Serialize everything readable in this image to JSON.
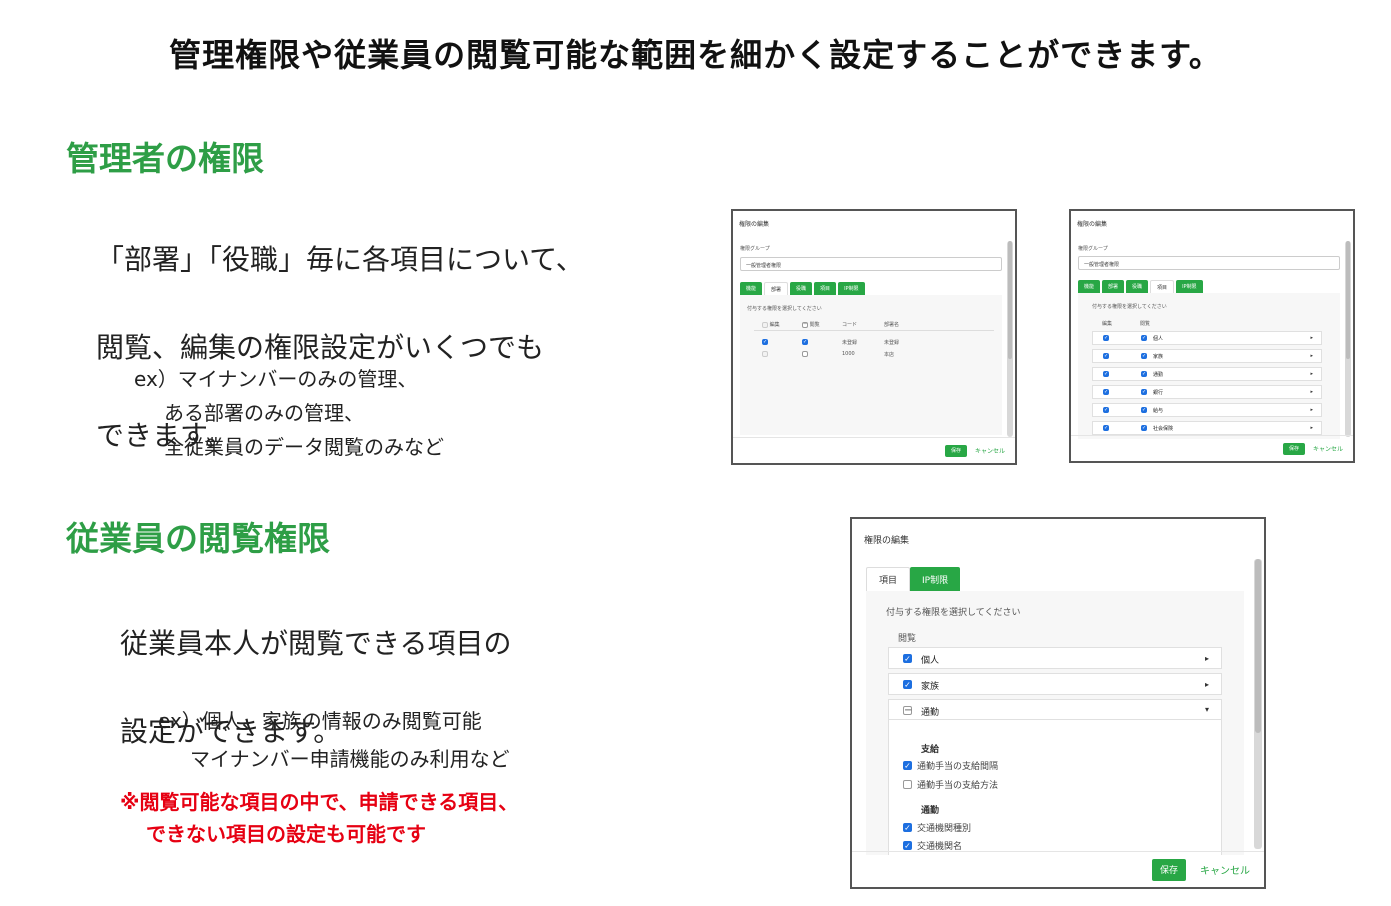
{
  "headline": "管理権限や従業員の閲覧可能な範囲を細かく設定することができます。",
  "admin": {
    "heading": "管理者の権限",
    "body_lines": [
      "「部署」「役職」毎に各項目について、",
      "閲覧、編集の権限設定がいくつでも",
      "できます。"
    ],
    "ex_lines": [
      "ex）マイナンバーのみの管理、",
      "ある部署のみの管理、",
      "全従業員のデータ閲覧のみなど"
    ]
  },
  "employee": {
    "heading": "従業員の閲覧権限",
    "body_lines": [
      "従業員本人が閲覧できる項目の",
      "設定ができます。"
    ],
    "ex_lines": [
      "ex）個人、家族の情報のみ閲覧可能",
      "マイナンバー申請機能のみ利用など"
    ],
    "note_lines": [
      "※閲覧可能な項目の中で、申請できる項目、",
      "できない項目の設定も可能です"
    ]
  },
  "dialog1": {
    "title": "権限の編集",
    "group_label": "権限グループ",
    "group_value": "一般管理者権限",
    "tabs": [
      "機能",
      "部署",
      "役職",
      "項目",
      "IP制限"
    ],
    "active_tab": "部署",
    "hint": "付与する権限を選択してください",
    "columns": [
      "編集",
      "閲覧",
      "コード",
      "部署名"
    ],
    "rows": [
      {
        "code": "未登録",
        "name": "未登録",
        "edit": true,
        "view": true
      },
      {
        "code": "1000",
        "name": "本店",
        "edit": false,
        "view": false
      }
    ],
    "save": "保存",
    "cancel": "キャンセル"
  },
  "dialog2": {
    "title": "権限の編集",
    "group_label": "権限グループ",
    "group_value": "一般管理者権限",
    "tabs": [
      "機能",
      "部署",
      "役職",
      "項目",
      "IP制限"
    ],
    "active_tab": "項目",
    "hint": "付与する権限を選択してください",
    "columns": [
      "編集",
      "閲覧"
    ],
    "items": [
      "個人",
      "家族",
      "通勤",
      "銀行",
      "給与",
      "社会保険"
    ],
    "save": "保存",
    "cancel": "キャンセル"
  },
  "dialog3": {
    "title": "権限の編集",
    "tabs": [
      "項目",
      "IP制限"
    ],
    "active_tab": "項目",
    "hint": "付与する権限を選択してください",
    "column": "閲覧",
    "items": [
      "個人",
      "家族",
      "通勤"
    ],
    "groups": [
      {
        "name": "支給",
        "options": [
          {
            "label": "通勤手当の支給間隔",
            "checked": true
          },
          {
            "label": "通勤手当の支給方法",
            "checked": false
          }
        ]
      },
      {
        "name": "通勤",
        "options": [
          {
            "label": "交通機関種別",
            "checked": true
          },
          {
            "label": "交通機関名",
            "checked": true
          }
        ]
      }
    ],
    "save": "保存",
    "cancel": "キャンセル"
  },
  "colors": {
    "accent_green": "#28a745",
    "heading_green": "#2e9e46",
    "note_red": "#e60012",
    "checkbox_blue": "#1d6fe0"
  },
  "icons": {
    "check": "check-icon",
    "minus": "minus-icon",
    "caret_right": "caret-right-icon",
    "caret_down": "caret-down-icon"
  }
}
